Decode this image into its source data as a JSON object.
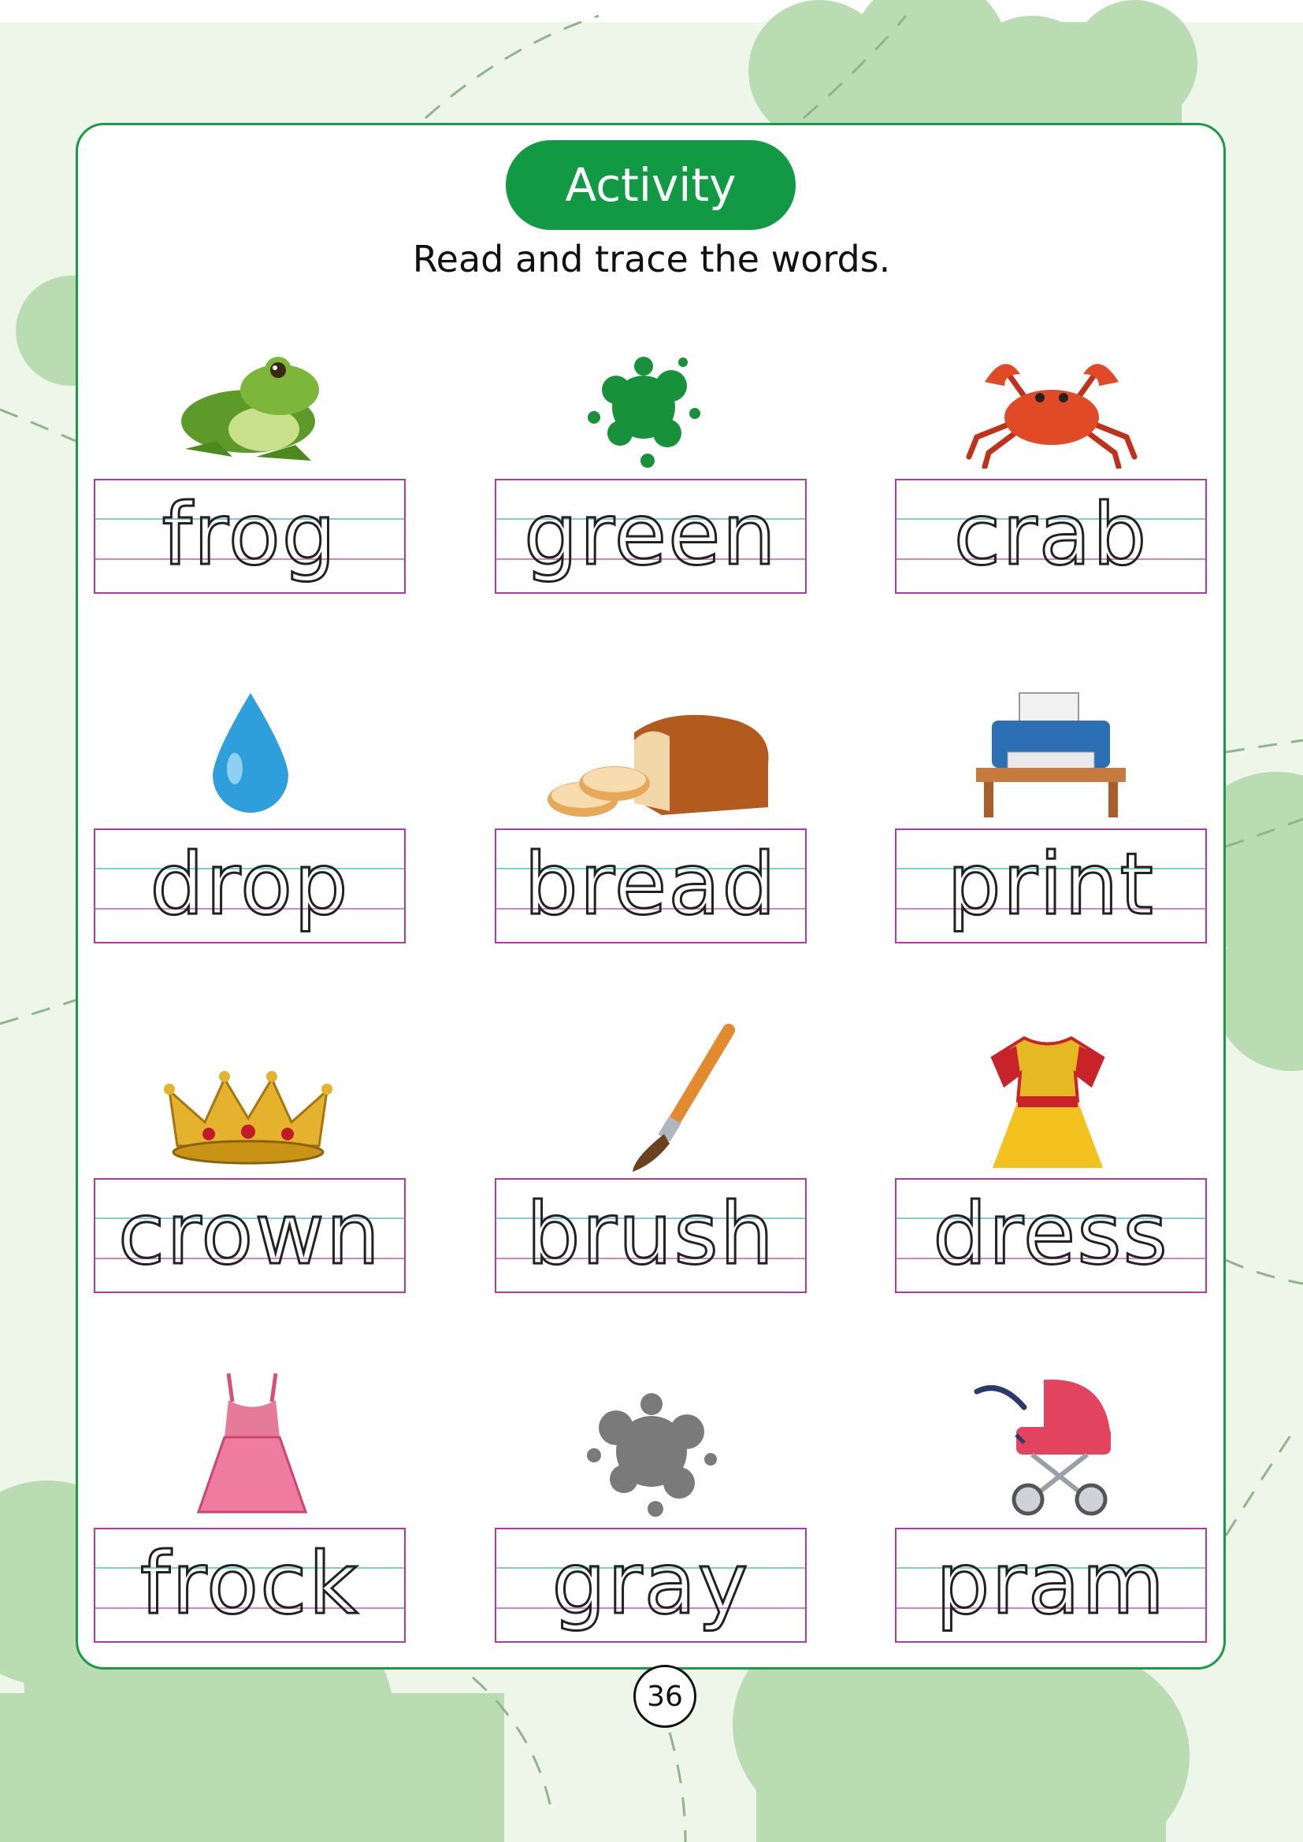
{
  "activity_title": "Activity",
  "instruction": "Read and trace the words.",
  "items": [
    {
      "word": "frog",
      "icon": "frog-icon"
    },
    {
      "word": "green",
      "icon": "green-splash-icon"
    },
    {
      "word": "crab",
      "icon": "crab-icon"
    },
    {
      "word": "drop",
      "icon": "water-drop-icon"
    },
    {
      "word": "bread",
      "icon": "bread-icon"
    },
    {
      "word": "print",
      "icon": "printer-icon"
    },
    {
      "word": "crown",
      "icon": "crown-icon"
    },
    {
      "word": "brush",
      "icon": "paintbrush-icon"
    },
    {
      "word": "dress",
      "icon": "dress-icon"
    },
    {
      "word": "frock",
      "icon": "frock-icon"
    },
    {
      "word": "gray",
      "icon": "gray-splash-icon"
    },
    {
      "word": "pram",
      "icon": "pram-icon"
    }
  ],
  "page_number": "36",
  "colors": {
    "accent": "#119a43",
    "background": "#eef6ea",
    "blob": "#b9dcb3",
    "trace_top_line": "#7ecfcf",
    "trace_box": "#b23a9a"
  }
}
